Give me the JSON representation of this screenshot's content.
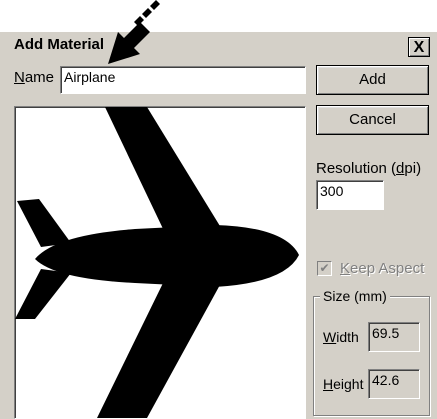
{
  "dialog": {
    "title": "Add Material",
    "close_glyph": "X",
    "name_label_u": "N",
    "name_label_rest": "ame",
    "name_value": "Airplane",
    "add_label": "Add",
    "cancel_label": "Cancel",
    "resolution_label_pre": "Resolution (",
    "resolution_label_u": "d",
    "resolution_label_post": "pi)",
    "resolution_value": "300",
    "keep_aspect_u": "K",
    "keep_aspect_rest": "eep Aspect",
    "keep_aspect_checked": true,
    "size_group_label": "Size (mm)",
    "width_label_u": "W",
    "width_label_rest": "idth",
    "width_value": "69.5",
    "height_label_u": "H",
    "height_label_rest": "eight",
    "height_value": "42.6"
  },
  "icons": {
    "pointer": "arrow-pointer-icon",
    "preview": "airplane-silhouette"
  }
}
